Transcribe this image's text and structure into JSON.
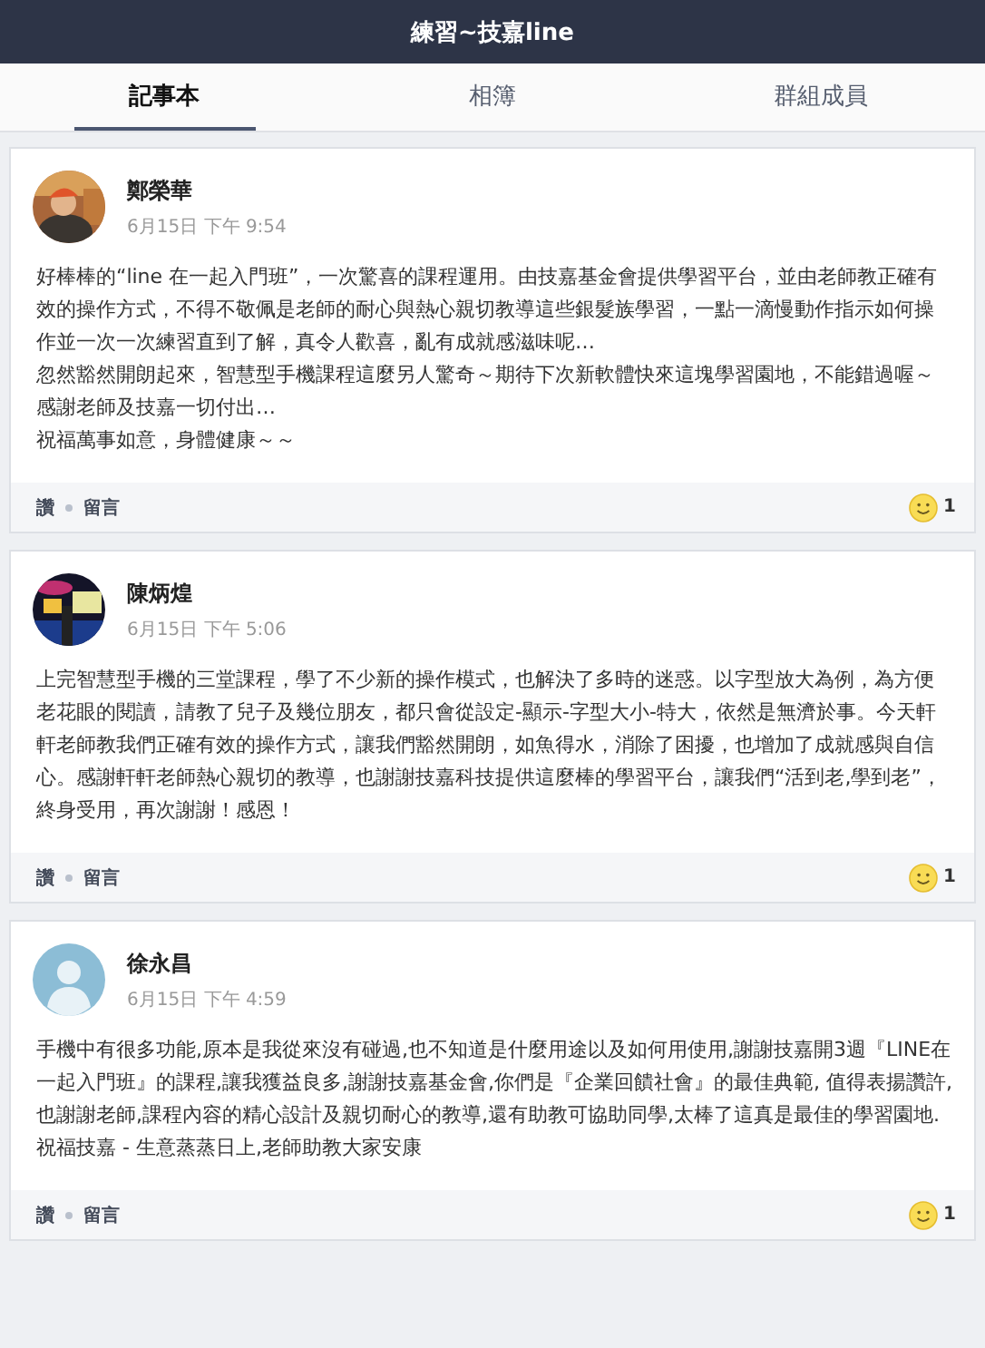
{
  "header": {
    "title": "練習~技嘉line"
  },
  "tabs": [
    {
      "label": "記事本",
      "selected": true
    },
    {
      "label": "相簿",
      "selected": false
    },
    {
      "label": "群組成員",
      "selected": false
    }
  ],
  "posts": [
    {
      "author": "鄭榮華",
      "time": "6月15日 下午 9:54",
      "body": [
        "好棒棒的“line 在一起入門班”，一次驚喜的課程運用。由技嘉基金會提供學習平台，並由老師教正確有效的操作方式，不得不敬佩是老師的耐心與熱心親切教導這些銀髮族學習，一點一滴慢動作指示如何操作並一次一次練習直到了解，真令人歡喜，亂有成就感滋味呢…",
        "忽然豁然開朗起來，智慧型手機課程這麼另人驚奇～期待下次新軟體快來這塊學習園地，不能錯過喔～",
        "感謝老師及技嘉一切付出…",
        "祝福萬事如意，身體健康～～"
      ],
      "like": "讚",
      "comment": "留言",
      "reaction_count": "1"
    },
    {
      "author": "陳炳煌",
      "time": "6月15日 下午 5:06",
      "body": [
        "上完智慧型手機的三堂課程，學了不少新的操作模式，也解決了多時的迷惑。以字型放大為例，為方便老花眼的閱讀，請教了兒子及幾位朋友，都只會從設定-顯示-字型大小-特大，依然是無濟於事。今天軒軒老師教我們正確有效的操作方式，讓我們豁然開朗，如魚得水，消除了困擾，也增加了成就感與自信心。感謝軒軒老師熱心親切的教導，也謝謝技嘉科技提供這麼棒的學習平台，讓我們“活到老,學到老”，終身受用，再次謝謝！感恩！"
      ],
      "like": "讚",
      "comment": "留言",
      "reaction_count": "1"
    },
    {
      "author": "徐永昌",
      "time": "6月15日 下午 4:59",
      "avatar": {
        "kind": "default"
      },
      "body": [
        "手機中有很多功能,原本是我從來沒有碰過,也不知道是什麼用途以及如何用使用,謝謝技嘉開3週『LINE在一起入門班』的課程,讓我獲益良多,謝謝技嘉基金會,你們是『企業回饋社會』的最佳典範, 值得表揚讚許,也謝謝老師,課程內容的精心設計及親切耐心的教導,還有助教可協助同學,太棒了這真是最佳的學習園地.                                                  祝福技嘉 - 生意蒸蒸日上,老師助教大家安康"
      ],
      "like": "讚",
      "comment": "留言",
      "reaction_count": "1"
    }
  ]
}
